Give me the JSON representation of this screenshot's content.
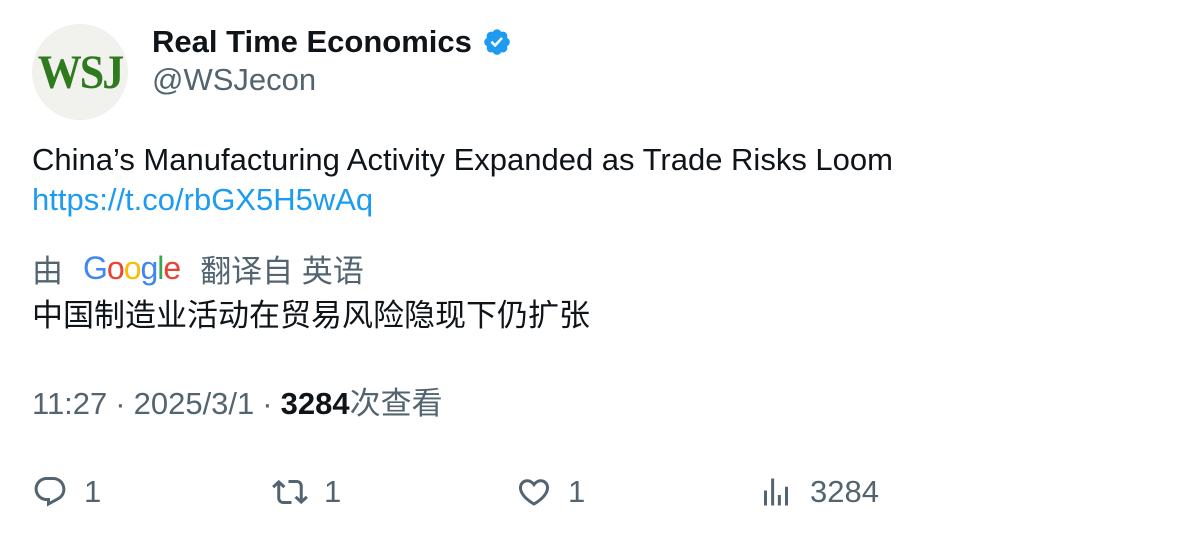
{
  "author": {
    "display_name": "Real Time Economics",
    "handle": "@WSJecon",
    "avatar_text": "WSJ",
    "verified": true
  },
  "tweet": {
    "text": "China’s Manufacturing Activity Expanded as Trade Risks Loom",
    "link": "https://t.co/rbGX5H5wAq"
  },
  "translation": {
    "prefix": "由",
    "provider_letters": [
      "G",
      "o",
      "o",
      "g",
      "l",
      "e"
    ],
    "suffix": "翻译自 英语",
    "text": "中国制造业活动在贸易风险隐现下仍扩张"
  },
  "meta": {
    "time": "11:27",
    "separator": "·",
    "date": "2025/3/1",
    "views": "3284",
    "views_suffix": "次查看"
  },
  "actions": {
    "replies": "1",
    "retweets": "1",
    "likes": "1",
    "views": "3284"
  },
  "colors": {
    "text": "#0f1419",
    "secondary": "#536471",
    "link": "#1d9bf0",
    "verified": "#1d9bf0",
    "wsj_green": "#2f7a1f"
  },
  "icons": {
    "verified": "verified-badge-icon",
    "reply": "reply-icon",
    "retweet": "retweet-icon",
    "like": "heart-icon",
    "views": "bar-chart-icon"
  }
}
